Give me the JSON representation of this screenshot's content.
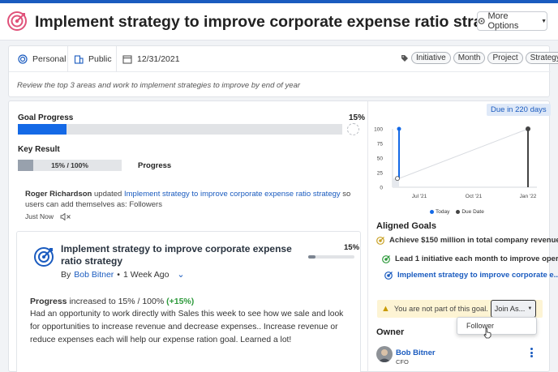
{
  "header": {
    "title": "Implement strategy to improve corporate expense ratio strategy",
    "more_options_label": "More Options",
    "icon": "target-icon"
  },
  "meta": {
    "visibility_label": "Personal",
    "access_label": "Public",
    "due_date": "12/31/2021",
    "tags": [
      "Initiative",
      "Month",
      "Project",
      "Strategy"
    ],
    "description": "Review the top 3 areas and work to implement strategies to improve by end of year"
  },
  "goal_progress": {
    "label": "Goal Progress",
    "percent_text": "15%",
    "percent": 15
  },
  "key_result": {
    "label": "Key Result",
    "value_text": "15% / 100%",
    "percent": 15,
    "metric_label": "Progress"
  },
  "activity": {
    "user": "Roger Richardson",
    "action": "updated",
    "goal_link": "Implement strategy to improve corporate expense ratio strategy",
    "rest": "so users can add themselves as: Followers",
    "time": "Just Now"
  },
  "sub_card": {
    "title": "Implement strategy to improve corporate expense ratio strategy",
    "by": "By",
    "author": "Bob Bitner",
    "time": "1 Week Ago",
    "percent_text": "15%",
    "percent": 15,
    "progress_label": "Progress",
    "progress_change": "increased to 15% / 100%",
    "progress_delta": "(+15%)",
    "body": "Had an opportunity to work directly with Sales this week to see how we sale and look for opportunities to increase revenue and decrease expenses.. Increase revenue or reduce expenses each will help our expense ration goal. Learned a lot!"
  },
  "chart": {
    "due_badge": "Due in 220 days",
    "legend_today": "Today",
    "legend_due": "Due Date"
  },
  "chart_data": {
    "type": "line",
    "y_ticks": [
      "100",
      "75",
      "50",
      "25",
      "0"
    ],
    "x_ticks": [
      "Jul '21",
      "Oct '21",
      "Jan '22"
    ],
    "ylim": [
      0,
      100
    ],
    "series": [
      {
        "name": "Today",
        "values": [
          15
        ],
        "color": "#1469e6"
      },
      {
        "name": "Due Date",
        "values": [
          100
        ],
        "color": "#444444"
      }
    ]
  },
  "aligned_goals": {
    "heading": "Aligned Goals",
    "items": [
      {
        "label": "Achieve $150 million in total company revenue...",
        "color": "#c9a227",
        "link": false
      },
      {
        "label": "Lead 1 initiative each month to improve oper...",
        "color": "#2e9a3c",
        "link": false
      },
      {
        "label": "Implement strategy to improve corporate e...",
        "color": "#1a5bbf",
        "link": true
      }
    ]
  },
  "join": {
    "warning": "You are not part of this goal.",
    "button_label": "Join As...",
    "option": "Follower"
  },
  "owner": {
    "heading": "Owner",
    "name": "Bob Bitner",
    "role": "CFO"
  },
  "colors": {
    "brand": "#1a5bbf",
    "progress": "#1469e6",
    "icon_pink": "#e0527a"
  }
}
